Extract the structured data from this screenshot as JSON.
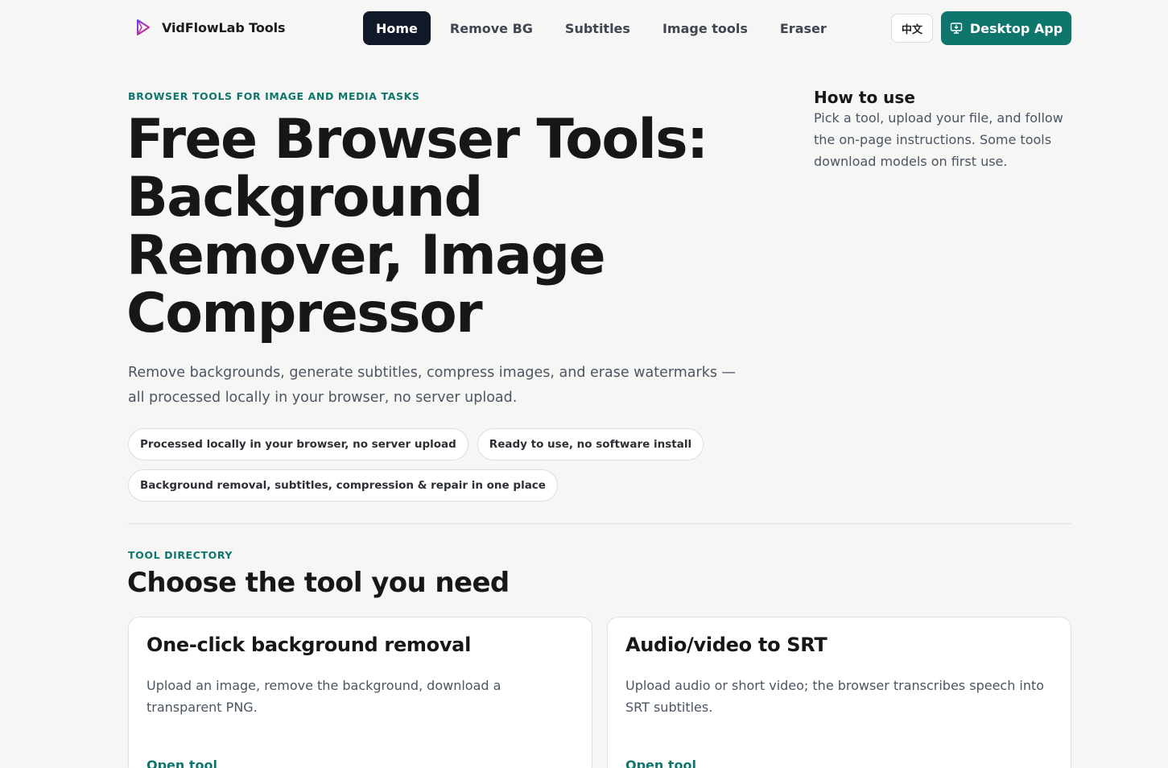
{
  "header": {
    "brand_name": "VidFlowLab Tools",
    "nav": [
      {
        "label": "Home",
        "active": true
      },
      {
        "label": "Remove BG",
        "active": false
      },
      {
        "label": "Subtitles",
        "active": false
      },
      {
        "label": "Image tools",
        "active": false
      },
      {
        "label": "Eraser",
        "active": false
      }
    ],
    "lang_label": "中文",
    "desktop_label": "Desktop App",
    "desktop_icon": "monitor-download-icon"
  },
  "hero": {
    "eyebrow": "BROWSER TOOLS FOR IMAGE AND MEDIA TASKS",
    "title": "Free Browser Tools: Background Remover, Image Compressor",
    "description": "Remove backgrounds, generate subtitles, compress images, and erase watermarks — all processed locally in your browser, no server upload.",
    "pills": [
      "Processed locally in your browser, no server upload",
      "Ready to use, no software install",
      "Background removal, subtitles, compression & repair in one place"
    ]
  },
  "how_to": {
    "title": "How to use",
    "text": "Pick a tool, upload your file, and follow the on-page instructions. Some tools download models on first use."
  },
  "directory": {
    "eyebrow": "TOOL DIRECTORY",
    "title": "Choose the tool you need",
    "cards": [
      {
        "title": "One-click background removal",
        "description": "Upload an image, remove the background, download a transparent PNG.",
        "link": "Open tool"
      },
      {
        "title": "Audio/video to SRT",
        "description": "Upload audio or short video; the browser transcribes speech into SRT subtitles.",
        "link": "Open tool"
      }
    ]
  },
  "colors": {
    "accent": "#0f766e",
    "nav_active_bg": "#111827",
    "background": "#f6f6f4"
  }
}
